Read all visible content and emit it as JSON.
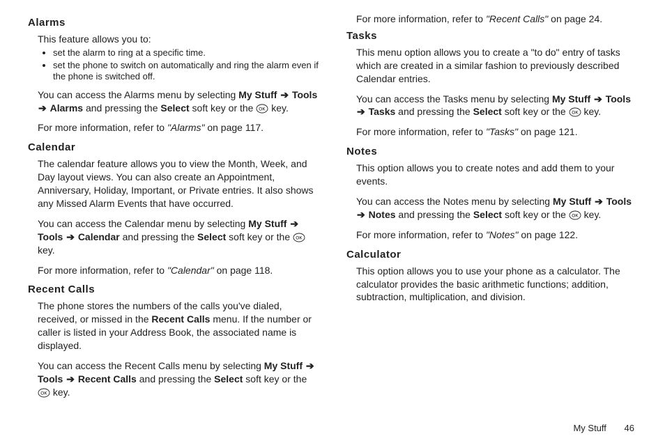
{
  "arrow": "➔",
  "okLabel": "OK",
  "sections": {
    "alarms": {
      "heading": "Alarms",
      "intro": "This feature allows you to:",
      "bullets": [
        "set the alarm to ring at a specific time.",
        "set the phone to switch on automatically and ring the alarm even if the phone is switched off."
      ],
      "access_pre": "You can access the Alarms menu by selecting ",
      "path1": "My Stuff",
      "path2": "Tools",
      "path3": "Alarms",
      "access_mid": " and pressing the ",
      "select": "Select",
      "access_post": " soft key or the ",
      "access_end": " key.",
      "moreinfo_pre": "For more information, refer to ",
      "moreinfo_ref": "\"Alarms\"",
      "moreinfo_post": "  on page 117."
    },
    "calendar": {
      "heading": "Calendar",
      "desc": "The calendar feature allows you to view the Month, Week, and Day layout views. You can also create an Appointment, Anniversary, Holiday, Important, or Private entries. It also shows any Missed Alarm Events that have occurred.",
      "access_pre": "You can access the Calendar menu by selecting ",
      "path1": "My Stuff",
      "path2": "Tools",
      "path3": "Calendar",
      "access_mid": " and pressing the ",
      "select": "Select",
      "access_post": " soft key or the ",
      "access_end": " key.",
      "moreinfo_pre": "For more information, refer to ",
      "moreinfo_ref": "\"Calendar\"",
      "moreinfo_post": "  on page 118."
    },
    "recent": {
      "heading": "Recent Calls",
      "desc_pre": "The phone stores the numbers of the calls you've dialed, received, or missed in the ",
      "desc_bold": "Recent Calls",
      "desc_post": " menu. If the number or caller is listed in your Address Book, the associated name is displayed.",
      "access_pre": "You can access the Recent Calls menu by selecting ",
      "path1": "My Stuff",
      "path2": "Tools",
      "path3": "Recent Calls",
      "access_mid": " and pressing the ",
      "select": "Select",
      "access_post": " soft key or the ",
      "access_end": " key.",
      "moreinfo_pre": "For more information, refer to ",
      "moreinfo_ref": "\"Recent Calls\"",
      "moreinfo_post": "  on page 24."
    },
    "tasks": {
      "heading": "Tasks",
      "desc": "This menu option allows you to create a \"to do\" entry of tasks which are created in a similar fashion to previously described Calendar entries.",
      "access_pre": "You can access the Tasks menu by selecting ",
      "path1": "My Stuff",
      "path2": "Tools",
      "path3": "Tasks",
      "access_mid": " and pressing the ",
      "select": "Select",
      "access_post": " soft key or the ",
      "access_end": " key.",
      "moreinfo_pre": "For more information, refer to ",
      "moreinfo_ref": "\"Tasks\"",
      "moreinfo_post": "  on page 121."
    },
    "notes": {
      "heading": "Notes",
      "desc": "This option allows you to create notes and add them to your events.",
      "access_pre": "You can access the Notes menu by selecting ",
      "path1": "My Stuff",
      "path2": "Tools",
      "path3": "Notes",
      "access_mid": " and pressing the ",
      "select": "Select",
      "access_post": " soft key or the ",
      "access_end": " key.",
      "moreinfo_pre": "For more information, refer to ",
      "moreinfo_ref": "\"Notes\"",
      "moreinfo_post": "  on page 122."
    },
    "calculator": {
      "heading": "Calculator",
      "desc": "This option allows you to use your phone as a calculator. The calculator provides the basic arithmetic functions; addition, subtraction, multiplication, and division."
    }
  },
  "footer": {
    "section": "My Stuff",
    "page": "46"
  }
}
